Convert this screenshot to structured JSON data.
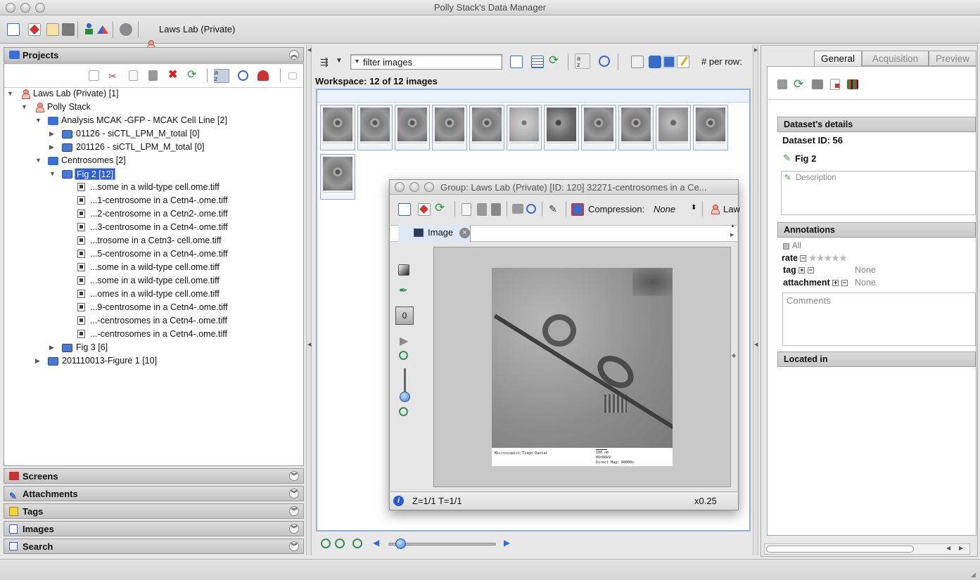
{
  "window": {
    "title": "Polly Stack's Data Manager"
  },
  "toolbar": {
    "user_label": "Laws Lab (Private)"
  },
  "left": {
    "projects_title": "Projects",
    "tree": [
      {
        "label": "Laws Lab (Private) [1]"
      },
      {
        "label": "Polly Stack"
      },
      {
        "label": "Analysis MCAK -GFP - MCAK Cell Line [2]"
      },
      {
        "label": "01126 - siCTL_LPM_M_total [0]"
      },
      {
        "label": "201126 - siCTL_LPM_M_total [0]"
      },
      {
        "label": "Centrosomes [2]"
      },
      {
        "label": "Fig 2 [12]"
      },
      {
        "label": "...some in a wild-type cell.ome.tiff"
      },
      {
        "label": "...1-centrosome in a Cetn4-.ome.tiff"
      },
      {
        "label": "...2-centrosome in a Cetn2-.ome.tiff"
      },
      {
        "label": "...3-centrosome in a Cetn4-.ome.tiff"
      },
      {
        "label": "...trosome in a Cetn3- cell.ome.tiff"
      },
      {
        "label": "...5-centrosome in a Cetn4-.ome.tiff"
      },
      {
        "label": "...some in a wild-type cell.ome.tiff"
      },
      {
        "label": "...some in a wild-type cell.ome.tiff"
      },
      {
        "label": "...omes in a wild-type cell.ome.tiff"
      },
      {
        "label": "...9-centrosome in a Cetn4-.ome.tiff"
      },
      {
        "label": "...-centrosomes in a Cetn4-.ome.tiff"
      },
      {
        "label": "...-centrosomes in a Cetn4-.ome.tiff"
      },
      {
        "label": "Fig 3 [6]"
      },
      {
        "label": "201110013-Figure 1 [10]"
      }
    ],
    "sections": [
      "Screens",
      "Attachments",
      "Tags",
      "Images",
      "Search"
    ]
  },
  "center": {
    "filter_value": "filter  images",
    "per_row_label": "# per row:",
    "workspace_label": "Workspace: 12 of 12 images"
  },
  "viewer": {
    "title": "Group: Laws Lab (Private) [ID: 120] 32271-centrosomes in a Ce...",
    "compression_label": "Compression:",
    "compression_value": "None",
    "user_trunc": "Law",
    "tab_label": "Image",
    "channel_value": "0",
    "status": "Z=1/1 T=1/1",
    "zoom": "x0.25",
    "caption_left": "Microscopist:Tiago Dantas",
    "caption_scale": "100 nm",
    "caption_kv": "HV=80kV",
    "caption_mag": "Direct Mag: 60000x"
  },
  "right": {
    "tabs": [
      "General",
      "Acquisition",
      "Preview"
    ],
    "details_header": "Dataset's details",
    "dataset_id": "Dataset ID: 56",
    "dataset_name": "Fig 2",
    "description_placeholder": "Description",
    "annotations_header": "Annotations",
    "all_label": "All",
    "rate_label": "rate",
    "tag_label": "tag",
    "tag_value": "None",
    "attachment_label": "attachment",
    "attachment_value": "None",
    "comments_placeholder": "Comments",
    "located_header": "Located in"
  }
}
